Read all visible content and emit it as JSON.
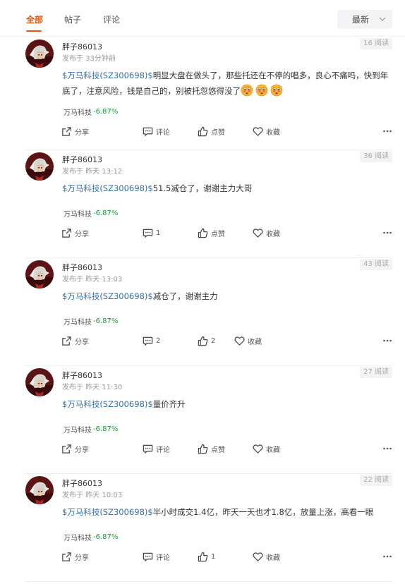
{
  "tabs": [
    {
      "label": "全部",
      "active": true
    },
    {
      "label": "帖子",
      "active": false
    },
    {
      "label": "评论",
      "active": false
    }
  ],
  "sort": {
    "label": "最新",
    "icon": "chevron-down-icon"
  },
  "colors": {
    "accent": "#ea5504",
    "link": "#2f6fb7",
    "down": "#1a9a3a"
  },
  "posts": [
    {
      "user": "胖子86013",
      "time": "发布于 33分钟前",
      "reads": "16 阅读",
      "stock_tag": "$万马科技(SZ300698)$",
      "text": "明显大盘在做头了，那些托还在不停的唱多，良心不痛吗，快到年底了，注意风险，钱是自己的，别被托忽悠得没了",
      "emojis": [
        "flushed-face-icon",
        "flushed-face-icon",
        "flushed-face-icon"
      ],
      "quote_name": "万马科技",
      "quote_change": "-6.87%",
      "share": "分享",
      "comment": "评论",
      "like": "点赞",
      "collect": "收藏"
    },
    {
      "user": "胖子86013",
      "time": "发布于 昨天 13:12",
      "reads": "36 阅读",
      "stock_tag": "$万马科技(SZ300698)$",
      "text": "51.5减仓了，谢谢主力大哥",
      "emojis": [],
      "quote_name": "万马科技",
      "quote_change": "-6.87%",
      "share": "分享",
      "comment": "1",
      "like": "点赞",
      "collect": "收藏"
    },
    {
      "user": "胖子86013",
      "time": "发布于 昨天 13:03",
      "reads": "43 阅读",
      "stock_tag": "$万马科技(SZ300698)$",
      "text": "减仓了，谢谢主力",
      "emojis": [],
      "quote_name": "万马科技",
      "quote_change": "-6.87%",
      "share": "分享",
      "comment": "2",
      "like": "2",
      "collect": "收藏"
    },
    {
      "user": "胖子86013",
      "time": "发布于 昨天 11:30",
      "reads": "27 阅读",
      "stock_tag": "$万马科技(SZ300698)$",
      "text": "量价齐升",
      "emojis": [],
      "quote_name": "万马科技",
      "quote_change": "-6.87%",
      "share": "分享",
      "comment": "评论",
      "like": "点赞",
      "collect": "收藏"
    },
    {
      "user": "胖子86013",
      "time": "发布于 昨天 10:03",
      "reads": "22 阅读",
      "stock_tag": "$万马科技(SZ300698)$",
      "text": "半小时成交1.4亿，昨天一天也才1.8亿，放量上涨，高看一眼",
      "emojis": [],
      "quote_name": "万马科技",
      "quote_change": "-6.87%",
      "share": "分享",
      "comment": "评论",
      "like": "1",
      "collect": "收藏"
    }
  ]
}
